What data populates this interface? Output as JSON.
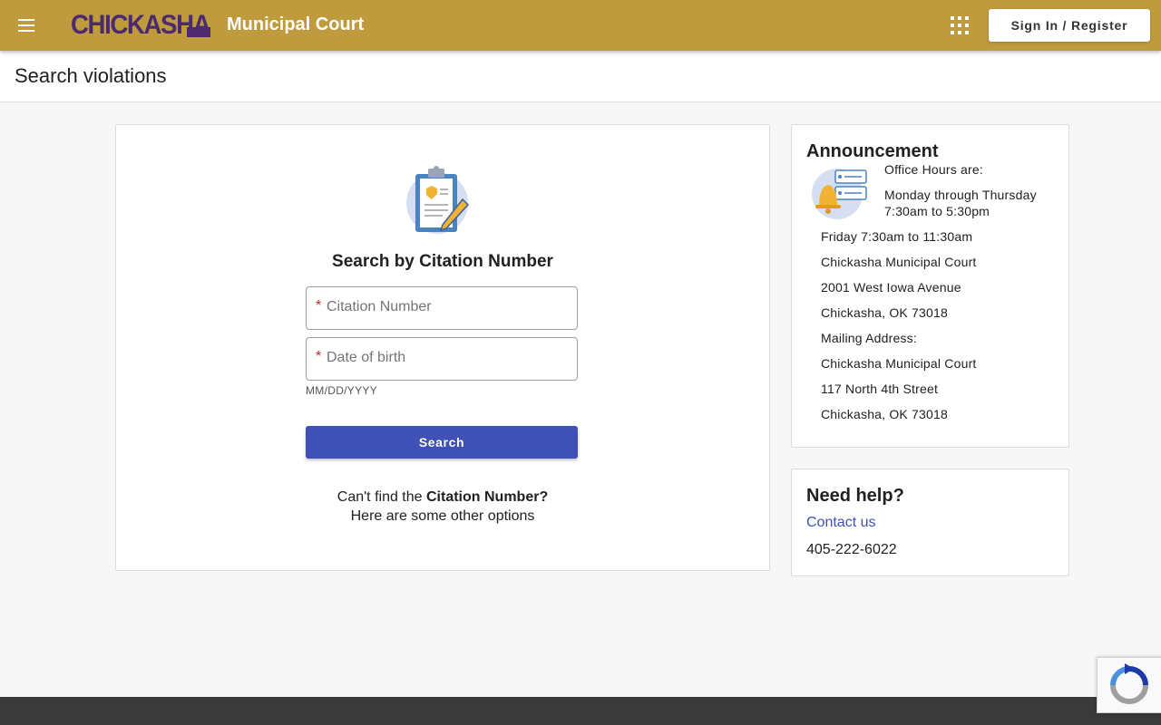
{
  "header": {
    "logo_text": "CHICKASHA",
    "app_title": "Municipal Court",
    "signin_label": "Sign In / Register"
  },
  "page": {
    "title": "Search violations"
  },
  "search": {
    "heading": "Search by Citation Number",
    "citation_placeholder": "Citation Number",
    "dob_placeholder": "Date of birth",
    "required_mark": "*",
    "dob_hint": "MM/DD/YYYY",
    "button_label": "Search",
    "cant_find_prefix": "Can't find the ",
    "cant_find_bold": "Citation Number?",
    "other_options": "Here are some other options"
  },
  "announcement": {
    "title": "Announcement",
    "lines": [
      "Office Hours are:",
      "Monday through Thursday",
      "7:30am to 5:30pm",
      "Friday 7:30am to 11:30am",
      "Chickasha Municipal Court",
      "2001 West Iowa Avenue",
      "Chickasha, OK 73018",
      "Mailing Address:",
      "Chickasha Municipal Court",
      "117 North 4th Street",
      "Chickasha, OK 73018"
    ]
  },
  "help": {
    "title": "Need help?",
    "contact_label": "Contact us",
    "phone": "405-222-6022"
  },
  "colors": {
    "header_bg": "#bf9b3e",
    "logo": "#4b2a6e",
    "primary_button": "#3f51b5",
    "link": "#3f51b5",
    "footer": "#3a3a3a"
  },
  "icons": [
    "menu-icon",
    "apps-grid-icon",
    "clipboard-icon",
    "bell-icon",
    "recaptcha-icon"
  ]
}
